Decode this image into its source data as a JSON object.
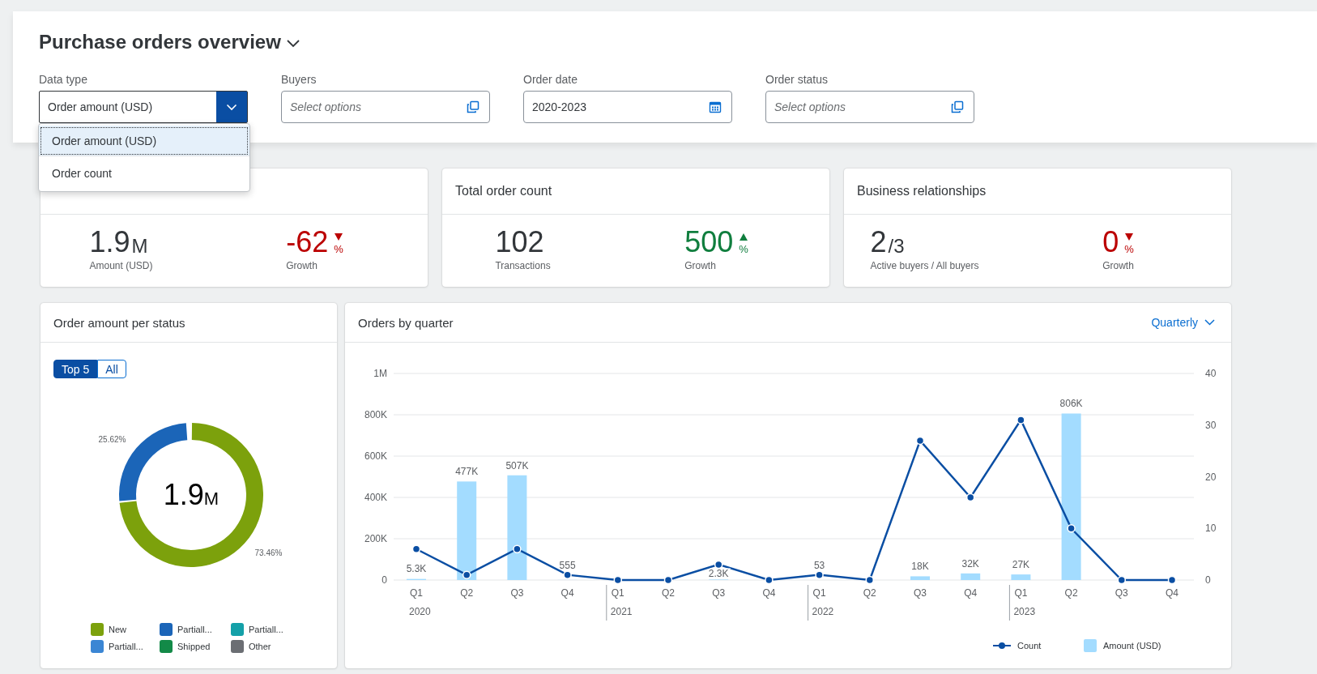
{
  "page": {
    "title": "Purchase orders overview"
  },
  "filters": [
    {
      "kind": "select",
      "label": "Data type",
      "value": "Order amount (USD)",
      "open": true,
      "options": [
        {
          "label": "Order amount (USD)",
          "selected": true
        },
        {
          "label": "Order count",
          "selected": false
        }
      ]
    },
    {
      "kind": "multi",
      "label": "Buyers",
      "placeholder": "Select options"
    },
    {
      "kind": "date",
      "label": "Order date",
      "value": "2020-2023"
    },
    {
      "kind": "multi",
      "label": "Order status",
      "placeholder": "Select options"
    }
  ],
  "kpis": [
    {
      "metrics": [
        {
          "kind": "plain",
          "value": "1.9",
          "unit": "M",
          "caption": "Amount (USD)"
        },
        {
          "kind": "falling",
          "value": "-62",
          "unit": "%",
          "caption": "Growth"
        }
      ]
    },
    {
      "title": "Total order count",
      "metrics": [
        {
          "kind": "plain",
          "value": "102",
          "caption": "Transactions"
        },
        {
          "kind": "rising",
          "value": "500",
          "unit": "%",
          "caption": "Growth"
        }
      ]
    },
    {
      "title": "Business relationships",
      "metrics": [
        {
          "kind": "plain",
          "value": "2",
          "unit": "/3",
          "caption": "Active buyers / All buyers"
        },
        {
          "kind": "falling",
          "value": "0",
          "unit": "%",
          "caption": "Growth"
        }
      ]
    }
  ],
  "status_card": {
    "title": "Order amount per status",
    "toggle": [
      {
        "label": "Top 5",
        "selected": true
      },
      {
        "label": "All",
        "selected": false
      }
    ],
    "center": {
      "value": "1.9",
      "unit": "M"
    },
    "chart_data": {
      "type": "donut",
      "categories": [
        "New",
        "Partiall...",
        "Partiall...",
        "Partiall...",
        "Shipped",
        "Other"
      ],
      "colors": [
        "#7ca10c",
        "#1b65b8",
        "#14a0a8",
        "#3b86d4",
        "#138a48",
        "#6b6e73"
      ],
      "values": [
        73.46,
        25.62,
        null,
        null,
        null,
        null
      ],
      "value_labels": [
        "73.46%",
        "25.62%",
        null,
        null,
        null,
        null
      ]
    }
  },
  "quarter_card": {
    "title": "Orders by quarter",
    "period": "Quarterly",
    "chart_data": {
      "type": "bar",
      "categories": [
        "Q1",
        "Q2",
        "Q3",
        "Q4",
        "Q1",
        "Q2",
        "Q3",
        "Q4",
        "Q1",
        "Q2",
        "Q3",
        "Q4",
        "Q1",
        "Q2",
        "Q3",
        "Q4"
      ],
      "annotations": [
        "2020",
        "2021",
        "2022",
        "2023"
      ],
      "grid": true,
      "legend": "bottom-right",
      "ylim": [
        0,
        1000000
      ],
      "yticks": [
        {
          "value": 0,
          "label": "0"
        },
        {
          "value": 200000,
          "label": "200K"
        },
        {
          "value": 400000,
          "label": "400K"
        },
        {
          "value": 600000,
          "label": "600K"
        },
        {
          "value": 800000,
          "label": "800K"
        },
        {
          "value": 1000000,
          "label": "1M"
        }
      ],
      "y2lim": [
        0,
        40
      ],
      "y2ticks": [
        0,
        10,
        20,
        30,
        40
      ],
      "series": [
        {
          "name": "Count",
          "type": "line",
          "axis": "y2",
          "marker": true,
          "color": "#0a4ea3",
          "values": [
            6,
            1,
            6,
            1,
            0,
            0,
            3,
            0,
            1,
            0,
            27,
            16,
            31,
            10,
            0,
            0
          ]
        },
        {
          "name": "Amount (USD)",
          "type": "bar",
          "color": "#a3dcff",
          "values": [
            5300,
            477000,
            507000,
            555,
            null,
            null,
            2300,
            null,
            53,
            null,
            18000,
            32000,
            27000,
            806000,
            null,
            null
          ],
          "value_labels": [
            "5.3K",
            "477K",
            "507K",
            "555",
            null,
            null,
            "2.3K",
            null,
            "53",
            null,
            "18K",
            "32K",
            "27K",
            "806K",
            null,
            null
          ]
        }
      ]
    }
  }
}
